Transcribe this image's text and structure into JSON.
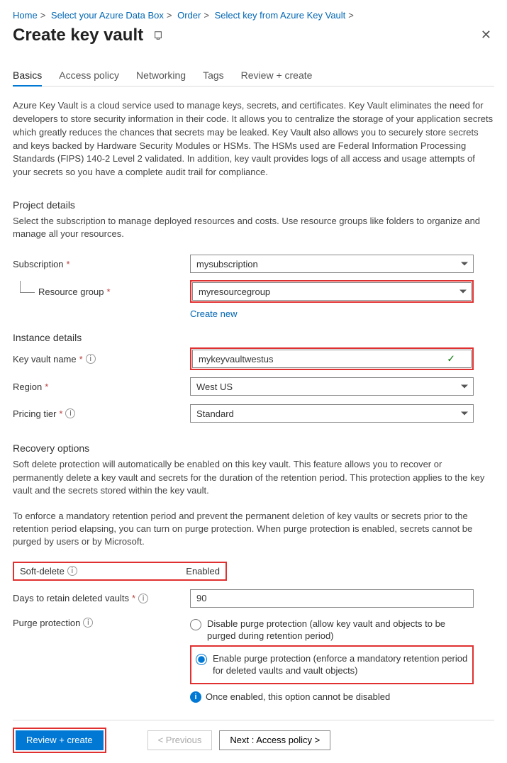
{
  "breadcrumb": [
    "Home",
    "Select your Azure Data Box",
    "Order",
    "Select key from Azure Key Vault"
  ],
  "page_title": "Create key vault",
  "tabs": [
    {
      "label": "Basics",
      "active": true
    },
    {
      "label": "Access policy",
      "active": false
    },
    {
      "label": "Networking",
      "active": false
    },
    {
      "label": "Tags",
      "active": false
    },
    {
      "label": "Review + create",
      "active": false
    }
  ],
  "intro": "Azure Key Vault is a cloud service used to manage keys, secrets, and certificates. Key Vault eliminates the need for developers to store security information in their code. It allows you to centralize the storage of your application secrets which greatly reduces the chances that secrets may be leaked. Key Vault also allows you to securely store secrets and keys backed by Hardware Security Modules or HSMs. The HSMs used are Federal Information Processing Standards (FIPS) 140-2 Level 2 validated. In addition, key vault provides logs of all access and usage attempts of your secrets so you have a complete audit trail for compliance.",
  "project_details": {
    "title": "Project details",
    "desc": "Select the subscription to manage deployed resources and costs. Use resource groups like folders to organize and manage all your resources.",
    "subscription_label": "Subscription",
    "subscription_value": "mysubscription",
    "resource_group_label": "Resource group",
    "resource_group_value": "myresourcegroup",
    "create_new": "Create new"
  },
  "instance": {
    "title": "Instance details",
    "name_label": "Key vault name",
    "name_value": "mykeyvaultwestus",
    "region_label": "Region",
    "region_value": "West US",
    "tier_label": "Pricing tier",
    "tier_value": "Standard"
  },
  "recovery": {
    "title": "Recovery options",
    "desc1": "Soft delete protection will automatically be enabled on this key vault. This feature allows you to recover or permanently delete a key vault and secrets for the duration of the retention period. This protection applies to the key vault and the secrets stored within the key vault.",
    "desc2": "To enforce a mandatory retention period and prevent the permanent deletion of key vaults or secrets prior to the retention period elapsing, you can turn on purge protection. When purge protection is enabled, secrets cannot be purged by users or by Microsoft.",
    "softdelete_label": "Soft-delete",
    "softdelete_value": "Enabled",
    "retain_label": "Days to retain deleted vaults",
    "retain_value": "90",
    "purge_label": "Purge protection",
    "purge_opt_disable": "Disable purge protection (allow key vault and objects to be purged during retention period)",
    "purge_opt_enable": "Enable purge protection (enforce a mandatory retention period for deleted vaults and vault objects)",
    "purge_note": "Once enabled, this option cannot be disabled"
  },
  "footer": {
    "review": "Review + create",
    "prev": "< Previous",
    "next": "Next : Access policy >"
  }
}
